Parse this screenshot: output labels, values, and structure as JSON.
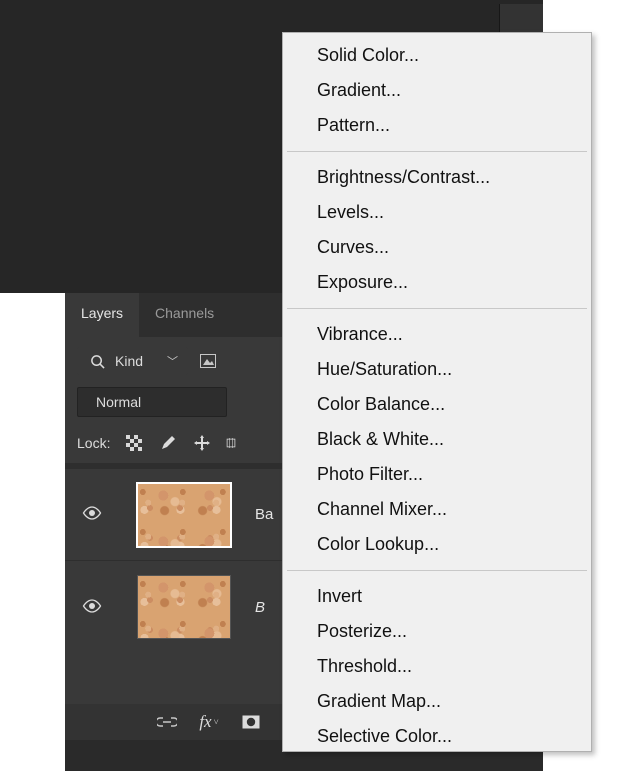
{
  "panel": {
    "tabs": [
      "Layers",
      "Channels"
    ],
    "active_tab": 0,
    "filter_label": "Kind",
    "blend_mode": "Normal",
    "lock_label": "Lock:",
    "layers": [
      {
        "name": "Ba",
        "visible": true,
        "selected": true,
        "italic": false
      },
      {
        "name": "B",
        "visible": true,
        "selected": false,
        "italic": true
      }
    ]
  },
  "menu": {
    "groups": [
      [
        "Solid Color...",
        "Gradient...",
        "Pattern..."
      ],
      [
        "Brightness/Contrast...",
        "Levels...",
        "Curves...",
        "Exposure..."
      ],
      [
        "Vibrance...",
        "Hue/Saturation...",
        "Color Balance...",
        "Black & White...",
        "Photo Filter...",
        "Channel Mixer...",
        "Color Lookup..."
      ],
      [
        "Invert",
        "Posterize...",
        "Threshold...",
        "Gradient Map...",
        "Selective Color..."
      ]
    ]
  }
}
